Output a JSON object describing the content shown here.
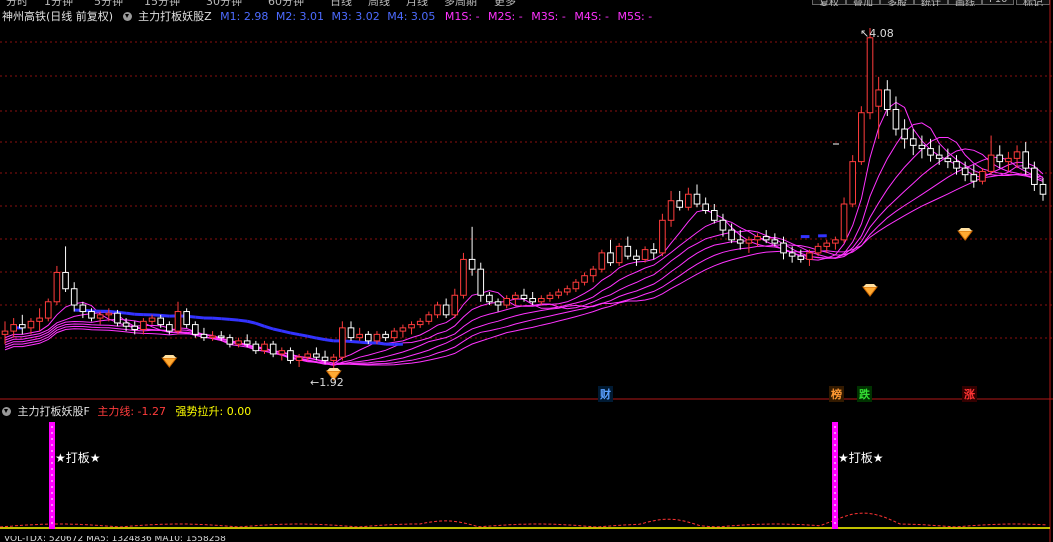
{
  "toolbar": {
    "items": [
      "分时",
      "1分钟",
      "5分钟",
      "15分钟",
      "30分钟",
      "60分钟",
      "日线",
      "周线",
      "月线",
      "多周期",
      "更多"
    ],
    "buttons": [
      "复权",
      "叠加",
      "多股",
      "统计",
      "画线",
      "F10",
      "标记"
    ]
  },
  "main_header": {
    "stock": "神州高铁(日线 前复权)",
    "indicator": "主力打板妖股Z",
    "m1": "M1: 2.98",
    "m2": "M2: 3.01",
    "m3": "M3: 3.02",
    "m4": "M4: 3.05",
    "m1s": "M1S: -",
    "m2s": "M2S: -",
    "m3s": "M3S: -",
    "m4s": "M4S: -",
    "m5s": "M5S: -"
  },
  "labels": {
    "high": "4.08",
    "low": "1.92"
  },
  "markers": [
    {
      "text": "财",
      "color": "#5aa0ff",
      "bg": "#001a33"
    },
    {
      "text": "榜",
      "color": "#ff9933",
      "bg": "#331a00"
    },
    {
      "text": "跌",
      "color": "#33dd33",
      "bg": "#003300"
    },
    {
      "text": "涨",
      "color": "#ff3333",
      "bg": "#330000"
    }
  ],
  "sub_header": {
    "indicator": "主力打板妖股F",
    "zhuli": "主力线: -1.27",
    "qiangshi": "强势拉升: 0.00"
  },
  "signal_text": "★打板★",
  "bottom_strip": "VOL-TDX: 520672  MA5: 1324836  MA10: 1558258",
  "colors": {
    "up": "#ff3c3c",
    "down": "#ffffff",
    "flat": "#ffffff",
    "ma_magenta": "#ff33ff",
    "ma_blue": "#3333ff",
    "grid": "#8a1010",
    "cyan": "#00ffff",
    "signal_bar": "#ff00ff",
    "yellow": "#ffff00"
  },
  "chart_data": {
    "type": "candlestick",
    "price_high_label": 4.08,
    "price_low_label": 1.92,
    "candles": [
      [
        2.2,
        2.28,
        2.14,
        2.22
      ],
      [
        2.22,
        2.3,
        2.18,
        2.26
      ],
      [
        2.26,
        2.32,
        2.2,
        2.24
      ],
      [
        2.24,
        2.3,
        2.2,
        2.28
      ],
      [
        2.28,
        2.36,
        2.22,
        2.3
      ],
      [
        2.3,
        2.42,
        2.28,
        2.4
      ],
      [
        2.4,
        2.62,
        2.38,
        2.58
      ],
      [
        2.58,
        2.74,
        2.46,
        2.48
      ],
      [
        2.48,
        2.52,
        2.34,
        2.38
      ],
      [
        2.38,
        2.4,
        2.3,
        2.34
      ],
      [
        2.34,
        2.36,
        2.28,
        2.3
      ],
      [
        2.3,
        2.34,
        2.26,
        2.32
      ],
      [
        2.32,
        2.36,
        2.28,
        2.33
      ],
      [
        2.33,
        2.35,
        2.25,
        2.27
      ],
      [
        2.27,
        2.3,
        2.22,
        2.25
      ],
      [
        2.25,
        2.28,
        2.2,
        2.23
      ],
      [
        2.23,
        2.3,
        2.2,
        2.28
      ],
      [
        2.28,
        2.32,
        2.26,
        2.3
      ],
      [
        2.3,
        2.32,
        2.24,
        2.26
      ],
      [
        2.26,
        2.28,
        2.2,
        2.22
      ],
      [
        2.22,
        2.4,
        2.2,
        2.34
      ],
      [
        2.34,
        2.36,
        2.24,
        2.26
      ],
      [
        2.26,
        2.28,
        2.18,
        2.2
      ],
      [
        2.2,
        2.24,
        2.16,
        2.18
      ],
      [
        2.18,
        2.22,
        2.16,
        2.19
      ],
      [
        2.19,
        2.22,
        2.16,
        2.18
      ],
      [
        2.18,
        2.2,
        2.12,
        2.14
      ],
      [
        2.14,
        2.18,
        2.12,
        2.16
      ],
      [
        2.16,
        2.2,
        2.12,
        2.14
      ],
      [
        2.14,
        2.16,
        2.08,
        2.1
      ],
      [
        2.1,
        2.16,
        2.08,
        2.14
      ],
      [
        2.14,
        2.16,
        2.06,
        2.08
      ],
      [
        2.08,
        2.12,
        2.04,
        2.1
      ],
      [
        2.1,
        2.12,
        2.02,
        2.04
      ],
      [
        2.04,
        2.08,
        2.0,
        2.06
      ],
      [
        2.06,
        2.1,
        2.04,
        2.08
      ],
      [
        2.08,
        2.12,
        2.04,
        2.06
      ],
      [
        2.06,
        2.1,
        2.02,
        2.04
      ],
      [
        2.04,
        2.08,
        1.92,
        2.06
      ],
      [
        2.06,
        2.28,
        2.04,
        2.24
      ],
      [
        2.24,
        2.28,
        2.16,
        2.18
      ],
      [
        2.18,
        2.24,
        2.16,
        2.2
      ],
      [
        2.2,
        2.22,
        2.14,
        2.16
      ],
      [
        2.16,
        2.22,
        2.14,
        2.2
      ],
      [
        2.2,
        2.22,
        2.16,
        2.18
      ],
      [
        2.18,
        2.24,
        2.16,
        2.22
      ],
      [
        2.22,
        2.26,
        2.18,
        2.24
      ],
      [
        2.24,
        2.28,
        2.2,
        2.26
      ],
      [
        2.26,
        2.3,
        2.24,
        2.28
      ],
      [
        2.28,
        2.34,
        2.26,
        2.32
      ],
      [
        2.32,
        2.4,
        2.3,
        2.38
      ],
      [
        2.38,
        2.42,
        2.3,
        2.32
      ],
      [
        2.32,
        2.48,
        2.3,
        2.44
      ],
      [
        2.44,
        2.7,
        2.42,
        2.66
      ],
      [
        2.66,
        2.86,
        2.56,
        2.6
      ],
      [
        2.6,
        2.64,
        2.4,
        2.44
      ],
      [
        2.44,
        2.46,
        2.38,
        2.4
      ],
      [
        2.4,
        2.42,
        2.34,
        2.38
      ],
      [
        2.38,
        2.44,
        2.36,
        2.42
      ],
      [
        2.42,
        2.46,
        2.38,
        2.44
      ],
      [
        2.44,
        2.48,
        2.4,
        2.42
      ],
      [
        2.42,
        2.46,
        2.38,
        2.4
      ],
      [
        2.4,
        2.44,
        2.38,
        2.42
      ],
      [
        2.42,
        2.46,
        2.4,
        2.44
      ],
      [
        2.44,
        2.48,
        2.42,
        2.46
      ],
      [
        2.46,
        2.5,
        2.44,
        2.48
      ],
      [
        2.48,
        2.54,
        2.46,
        2.52
      ],
      [
        2.52,
        2.58,
        2.5,
        2.56
      ],
      [
        2.56,
        2.62,
        2.52,
        2.6
      ],
      [
        2.6,
        2.72,
        2.58,
        2.7
      ],
      [
        2.7,
        2.78,
        2.62,
        2.64
      ],
      [
        2.64,
        2.76,
        2.62,
        2.74
      ],
      [
        2.74,
        2.8,
        2.66,
        2.68
      ],
      [
        2.68,
        2.72,
        2.62,
        2.66
      ],
      [
        2.66,
        2.74,
        2.64,
        2.72
      ],
      [
        2.72,
        2.76,
        2.66,
        2.7
      ],
      [
        2.7,
        2.94,
        2.68,
        2.9
      ],
      [
        2.9,
        3.08,
        2.86,
        3.02
      ],
      [
        3.02,
        3.08,
        2.96,
        2.98
      ],
      [
        2.98,
        3.1,
        2.96,
        3.06
      ],
      [
        3.06,
        3.12,
        2.98,
        3.0
      ],
      [
        3.0,
        3.04,
        2.94,
        2.96
      ],
      [
        2.96,
        3.0,
        2.88,
        2.9
      ],
      [
        2.9,
        2.94,
        2.8,
        2.84
      ],
      [
        2.84,
        2.88,
        2.76,
        2.78
      ],
      [
        2.78,
        2.84,
        2.72,
        2.76
      ],
      [
        2.76,
        2.8,
        2.7,
        2.78
      ],
      [
        2.78,
        2.82,
        2.74,
        2.8
      ],
      [
        2.8,
        2.84,
        2.76,
        2.78
      ],
      [
        2.78,
        2.82,
        2.74,
        2.76
      ],
      [
        2.76,
        2.8,
        2.66,
        2.7
      ],
      [
        2.7,
        2.74,
        2.64,
        2.68
      ],
      [
        2.68,
        2.72,
        2.64,
        2.66
      ],
      [
        2.66,
        2.72,
        2.62,
        2.7
      ],
      [
        2.7,
        2.76,
        2.68,
        2.74
      ],
      [
        2.74,
        2.78,
        2.7,
        2.76
      ],
      [
        2.76,
        2.8,
        2.72,
        2.78
      ],
      [
        2.78,
        3.04,
        2.76,
        3.0
      ],
      [
        3.0,
        3.3,
        2.98,
        3.26
      ],
      [
        3.26,
        3.6,
        3.24,
        3.56
      ],
      [
        3.56,
        4.08,
        3.52,
        4.02
      ],
      [
        3.6,
        3.78,
        3.4,
        3.7
      ],
      [
        3.7,
        3.76,
        3.54,
        3.58
      ],
      [
        3.58,
        3.66,
        3.42,
        3.46
      ],
      [
        3.46,
        3.52,
        3.34,
        3.4
      ],
      [
        3.4,
        3.46,
        3.3,
        3.36
      ],
      [
        3.36,
        3.42,
        3.28,
        3.34
      ],
      [
        3.34,
        3.4,
        3.26,
        3.3
      ],
      [
        3.3,
        3.36,
        3.24,
        3.28
      ],
      [
        3.28,
        3.34,
        3.22,
        3.26
      ],
      [
        3.26,
        3.3,
        3.18,
        3.22
      ],
      [
        3.22,
        3.26,
        3.14,
        3.18
      ],
      [
        3.18,
        3.24,
        3.1,
        3.14
      ],
      [
        3.14,
        3.22,
        3.12,
        3.2
      ],
      [
        3.2,
        3.42,
        3.18,
        3.3
      ],
      [
        3.3,
        3.36,
        3.22,
        3.26
      ],
      [
        3.26,
        3.32,
        3.2,
        3.28
      ],
      [
        3.28,
        3.36,
        3.22,
        3.32
      ],
      [
        3.32,
        3.38,
        3.18,
        3.22
      ],
      [
        3.22,
        3.26,
        3.08,
        3.12
      ],
      [
        3.12,
        3.16,
        3.02,
        3.06
      ]
    ]
  }
}
